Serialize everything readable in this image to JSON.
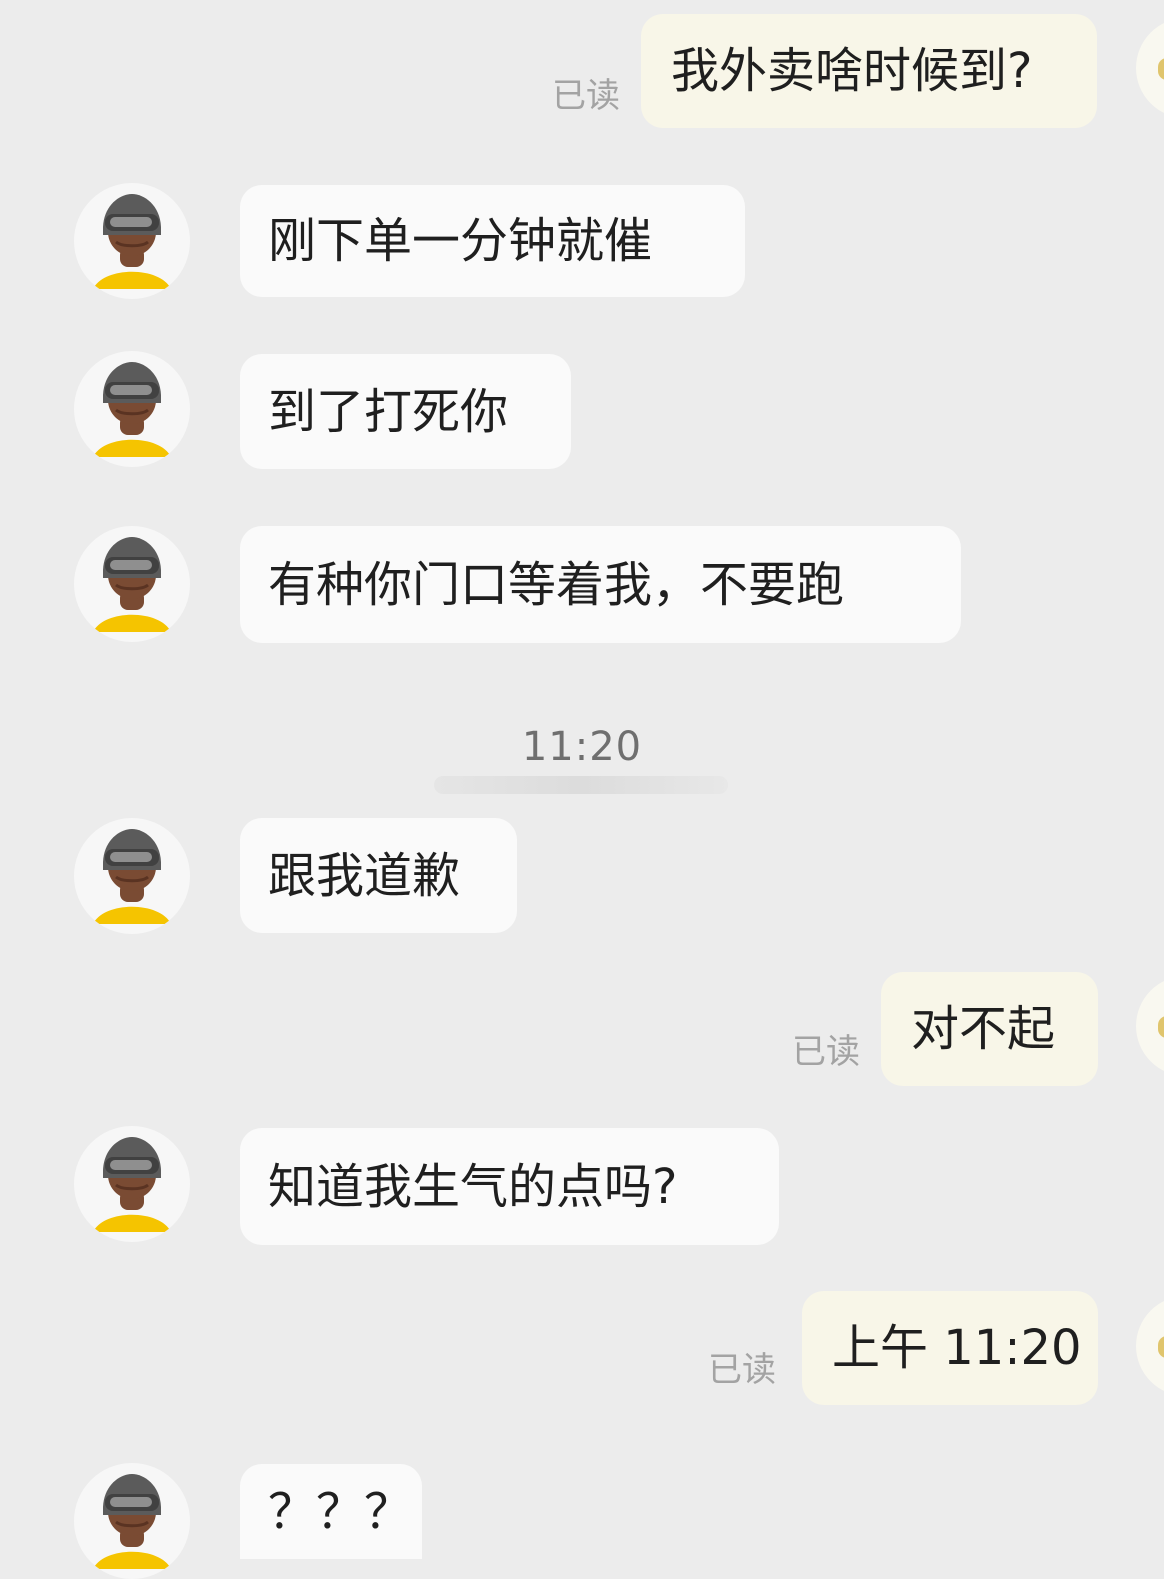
{
  "chat": {
    "timestamp": "11:20",
    "messages": [
      {
        "side": "right",
        "text": "我外卖啥时候到?",
        "read": "已读"
      },
      {
        "side": "left",
        "text": "刚下单一分钟就催"
      },
      {
        "side": "left",
        "text": "到了打死你"
      },
      {
        "side": "left",
        "text": "有种你门口等着我，不要跑"
      },
      {
        "side": "left",
        "text": "跟我道歉"
      },
      {
        "side": "right",
        "text": "对不起",
        "read": "已读"
      },
      {
        "side": "left",
        "text": "知道我生气的点吗?"
      },
      {
        "side": "right",
        "text": "上午 11:20",
        "read": "已读"
      },
      {
        "side": "left",
        "text": "？？？"
      }
    ]
  },
  "icons": {
    "courier_avatar": "courier-helmet-icon",
    "user_avatar": "user-avatar-icon"
  },
  "colors": {
    "background": "#ececec",
    "left_bubble": "#fafafa",
    "right_bubble": "#f8f6e8",
    "read_text": "#a3a3a3",
    "avatar_yellow": "#f5c400",
    "helmet": "#5b5b5b"
  }
}
